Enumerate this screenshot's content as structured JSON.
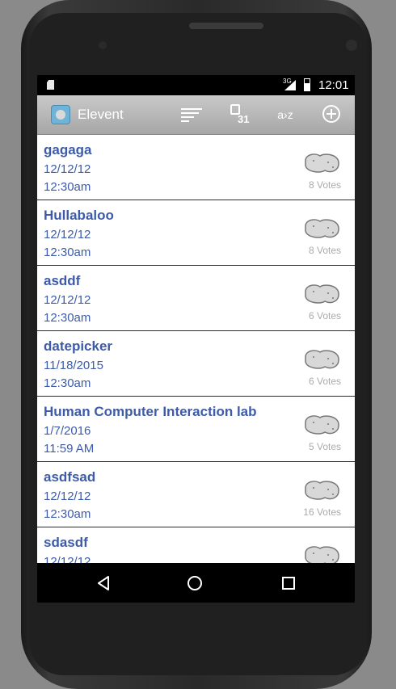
{
  "status": {
    "network": "3G",
    "time": "12:01"
  },
  "action_bar": {
    "title": "Elevent",
    "calendar_number": "31",
    "az_label": "a›z"
  },
  "events": [
    {
      "title": "gagaga",
      "date": "12/12/12",
      "time": "12:30am",
      "votes": "8 Votes"
    },
    {
      "title": "Hullabaloo",
      "date": "12/12/12",
      "time": "12:30am",
      "votes": "8 Votes"
    },
    {
      "title": "asddf",
      "date": "12/12/12",
      "time": "12:30am",
      "votes": "6 Votes"
    },
    {
      "title": "datepicker",
      "date": "11/18/2015",
      "time": "12:30am",
      "votes": "6 Votes"
    },
    {
      "title": "Human Computer Interaction lab",
      "date": "1/7/2016",
      "time": "11:59 AM",
      "votes": "5 Votes"
    },
    {
      "title": "asdfsad",
      "date": "12/12/12",
      "time": "12:30am",
      "votes": "16 Votes"
    },
    {
      "title": "sdasdf",
      "date": "12/12/12",
      "time": "",
      "votes": ""
    }
  ],
  "colors": {
    "title_blue": "#3d5ba9",
    "action_bar": "#b8b8b8",
    "vote_gray": "#aaaaaa"
  }
}
